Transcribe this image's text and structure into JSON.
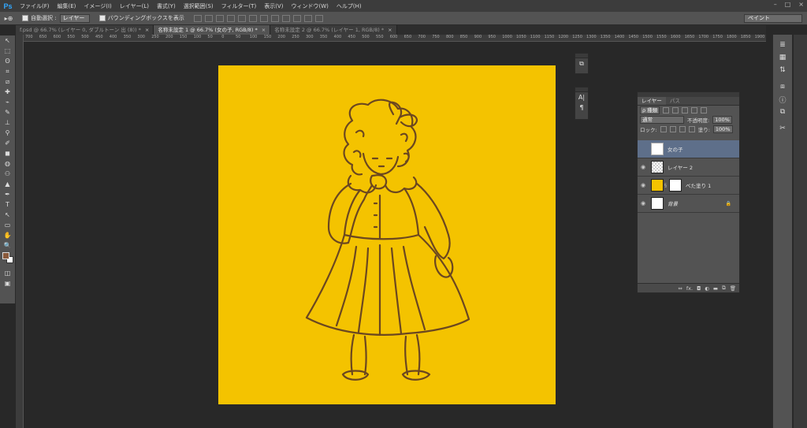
{
  "app": {
    "logo": "Ps"
  },
  "menu": [
    "ファイル(F)",
    "編集(E)",
    "イメージ(I)",
    "レイヤー(L)",
    "書式(Y)",
    "選択範囲(S)",
    "フィルター(T)",
    "表示(V)",
    "ウィンドウ(W)",
    "ヘルプ(H)"
  ],
  "window_controls": {
    "minimize": "–",
    "maximize": "□",
    "close": "×"
  },
  "options": {
    "tool_icon": "▸⊕",
    "auto_select_label": "自動選択 :",
    "auto_select_value": "レイヤー",
    "bounding_box_label": "バウンディングボックスを表示",
    "workspace": "ペイント"
  },
  "tabs": [
    {
      "label": "f.psd @ 66.7% (レイヤー 0, ダブルトーン 出 (8)) *",
      "close": "×"
    },
    {
      "label": "名称未設定 1 @ 66.7% (女の子, RGB/8) *",
      "close": "×"
    },
    {
      "label": "名称未設定 2 @ 66.7% (レイヤー 1, RGB/8) *",
      "close": "×"
    }
  ],
  "ruler_ticks": [
    "700",
    "650",
    "600",
    "550",
    "500",
    "450",
    "400",
    "350",
    "300",
    "250",
    "200",
    "150",
    "100",
    "50",
    "0",
    "50",
    "100",
    "150",
    "200",
    "250",
    "300",
    "350",
    "400",
    "450",
    "500",
    "550",
    "600",
    "650",
    "700",
    "750",
    "800",
    "850",
    "900",
    "950",
    "1000",
    "1050",
    "1100",
    "1150",
    "1200",
    "1250",
    "1300",
    "1350",
    "1400",
    "1450",
    "1500",
    "1550",
    "1600",
    "1650",
    "1700",
    "1750",
    "1800",
    "1850",
    "1900"
  ],
  "tools": [
    "↖",
    "⬚",
    "ʘ",
    "⌗",
    "⧄",
    "✚",
    "⌁",
    "✎",
    "⊥",
    "⚲",
    "✐",
    "◼",
    "◍",
    "⚇",
    "▲",
    "✒",
    "T",
    "↖",
    "▭",
    "✋",
    "🔍"
  ],
  "swatches": {
    "foreground": "#8a5a3c",
    "background": "#ffffff"
  },
  "mini_panel_1": {
    "icon": "⧉"
  },
  "mini_panel_2": {
    "icon_a": "A|",
    "icon_b": "¶"
  },
  "layers_panel": {
    "tabs": [
      "レイヤー",
      "パス"
    ],
    "kind_filter": "ρ 種類",
    "blend_mode": "通常",
    "opacity_label": "不透明度:",
    "opacity_value": "100%",
    "lock_label": "ロック:",
    "fill_label": "塗り:",
    "fill_value": "100%",
    "layers": [
      {
        "name": "女の子",
        "visible": false,
        "selected": true
      },
      {
        "name": "レイヤー 2",
        "visible": true,
        "selected": false
      },
      {
        "name": "べた塗り 1",
        "visible": true,
        "selected": false
      },
      {
        "name": "背景",
        "visible": true,
        "selected": false
      }
    ],
    "footer_icons": [
      "⇔",
      "fx.",
      "◘",
      "◐",
      "▬",
      "⧉",
      "🗑"
    ]
  },
  "right_dock": [
    "≣",
    "▦",
    "⇅",
    "⧈",
    "ⓘ",
    "⧉",
    "✂"
  ],
  "colors": {
    "canvas": "#f4c300",
    "drawing": "#6b4720",
    "selected_layer": "#5e6f8a"
  }
}
